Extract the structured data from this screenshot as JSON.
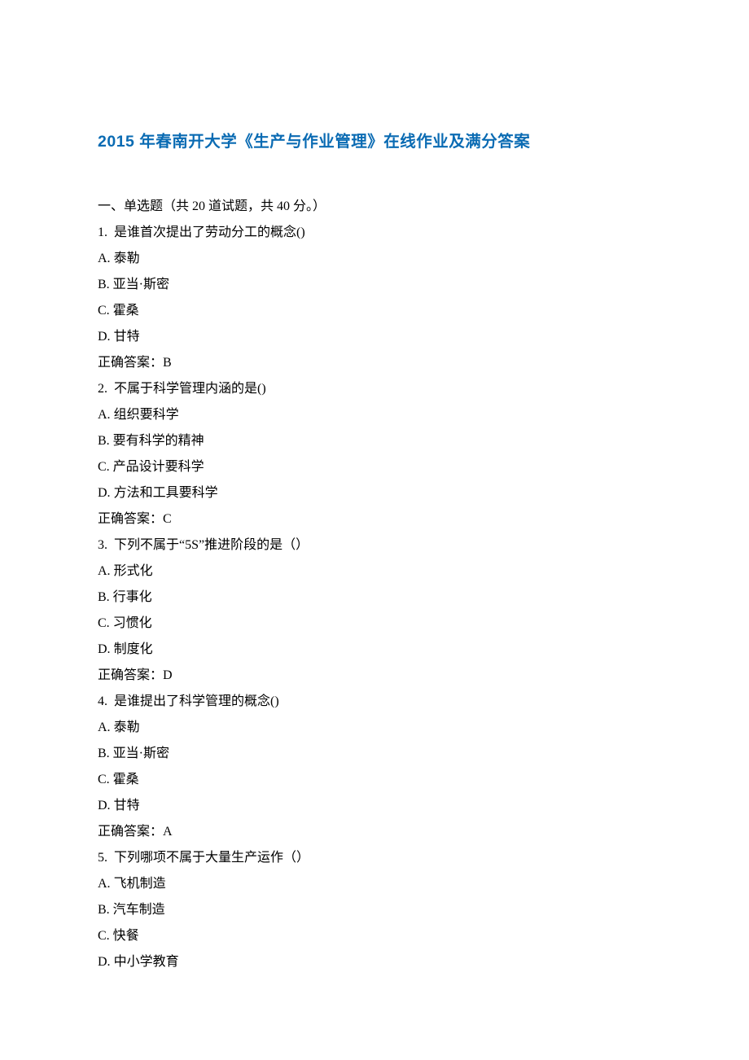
{
  "title": "2015 年春南开大学《生产与作业管理》在线作业及满分答案",
  "section_header": "一、单选题（共 20 道试题，共 40 分。）",
  "answer_prefix": "正确答案：",
  "questions": [
    {
      "num": "1. ",
      "stem": "是谁首次提出了劳动分工的概念()",
      "options": [
        {
          "label": "A.",
          "text": "泰勒"
        },
        {
          "label": "B.",
          "text": "亚当·斯密"
        },
        {
          "label": "C.",
          "text": "霍桑"
        },
        {
          "label": "D.",
          "text": "甘特"
        }
      ],
      "answer": "B"
    },
    {
      "num": "2. ",
      "stem": "不属于科学管理内涵的是()",
      "options": [
        {
          "label": "A.",
          "text": "组织要科学"
        },
        {
          "label": "B.",
          "text": "要有科学的精神"
        },
        {
          "label": "C.",
          "text": "产品设计要科学"
        },
        {
          "label": "D.",
          "text": "方法和工具要科学"
        }
      ],
      "answer": "C"
    },
    {
      "num": "3. ",
      "stem": "下列不属于“5S”推进阶段的是（）",
      "options": [
        {
          "label": "A.",
          "text": "形式化"
        },
        {
          "label": "B.",
          "text": "行事化"
        },
        {
          "label": "C.",
          "text": "习惯化"
        },
        {
          "label": "D.",
          "text": "制度化"
        }
      ],
      "answer": "D"
    },
    {
      "num": "4. ",
      "stem": "是谁提出了科学管理的概念()",
      "options": [
        {
          "label": "A.",
          "text": "泰勒"
        },
        {
          "label": "B.",
          "text": "亚当·斯密"
        },
        {
          "label": "C.",
          "text": "霍桑"
        },
        {
          "label": "D.",
          "text": "甘特"
        }
      ],
      "answer": "A"
    },
    {
      "num": "5. ",
      "stem": "下列哪项不属于大量生产运作（）",
      "options": [
        {
          "label": "A.",
          "text": "飞机制造"
        },
        {
          "label": "B.",
          "text": "汽车制造"
        },
        {
          "label": "C.",
          "text": "快餐"
        },
        {
          "label": "D.",
          "text": "中小学教育"
        }
      ],
      "answer": ""
    }
  ]
}
